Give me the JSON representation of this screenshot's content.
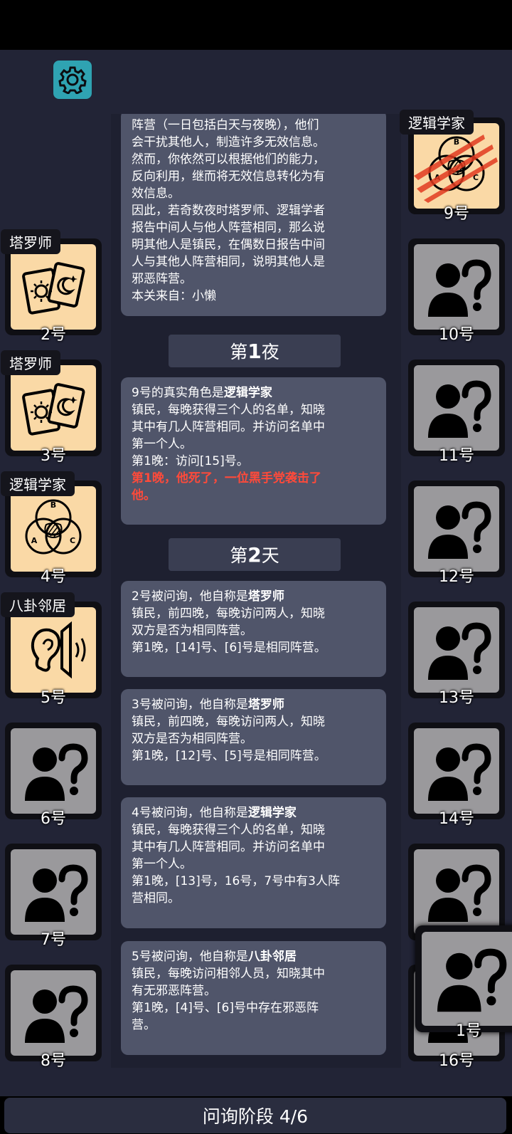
{
  "stage": "问询阶段 4/6",
  "intro": {
    "lines": [
      "阵营（一日包括白天与夜晚），他们",
      "会干扰其他人，制造许多无效信息。",
      "然而，你依然可以根据他们的能力，",
      "反向利用，继而将无效信息转化为有",
      "效信息。",
      "因此，若奇数夜时塔罗师、逻辑学者",
      "报告中间人与他人阵营相同，那么说",
      "明其他人是镇民，在偶数日报告中间",
      "人与其他人阵营相同，说明其他人是",
      "邪恶阵营。",
      "本关来自：小懒"
    ]
  },
  "phase1": {
    "pre": "第",
    "num": "1",
    "post": "夜"
  },
  "phase2": {
    "pre": "第",
    "num": "2",
    "post": "天"
  },
  "night1": {
    "head": "9号的真实角色是",
    "role": "逻辑学家",
    "lines": [
      "镇民，每晚获得三个人的名单，知晓",
      "其中有几人阵营相同。并访问名单中",
      "第一个人。",
      "第1晚：访问[15]号。"
    ],
    "red1": "第1晚，他死了，一位黑手党袭击了",
    "red2": "他。"
  },
  "q2": {
    "head": "2号被问询，他自称是",
    "role": "塔罗师",
    "lines": [
      "镇民，前四晚，每晚访问两人，知晓",
      "双方是否为相同阵营。",
      "第1晚，[14]号、[6]号是相同阵营。"
    ]
  },
  "q3": {
    "head": "3号被问询，他自称是",
    "role": "塔罗师",
    "lines": [
      "镇民，前四晚，每晚访问两人，知晓",
      "双方是否为相同阵营。",
      "第1晚，[12]号、[5]号是相同阵营。"
    ]
  },
  "q4": {
    "head": "4号被问询，他自称是",
    "role": "逻辑学家",
    "lines": [
      "镇民，每晚获得三个人的名单，知晓",
      "其中有几人阵营相同。并访问名单中",
      "第一个人。",
      "第1晚，[13]号，16号，7号中有3人阵",
      "营相同。"
    ]
  },
  "q5": {
    "head": "5号被问询，他自称是",
    "role": "八卦邻居",
    "lines": [
      "镇民，每晚访问相邻人员，知晓其中",
      "有无邪恶阵营。",
      "第1晚，[4]号、[6]号中存在邪恶阵",
      "营。"
    ]
  },
  "players": {
    "p1": "1号",
    "p2": "2号",
    "p3": "3号",
    "p4": "4号",
    "p5": "5号",
    "p6": "6号",
    "p7": "7号",
    "p8": "8号",
    "p9": "9号",
    "p10": "10号",
    "p11": "11号",
    "p12": "12号",
    "p13": "13号",
    "p14": "14号",
    "p16": "16号"
  },
  "tags": {
    "t2": "塔罗师",
    "t3": "塔罗师",
    "t4": "逻辑学家",
    "t5": "八卦邻居",
    "t9": "逻辑学家"
  },
  "venn_letters": {
    "a": "A",
    "b": "B",
    "c": "C"
  },
  "icons": {
    "settings": "gear-icon",
    "unknown": "unknown-person-icon",
    "tarot": "tarot-cards-icon",
    "logic": "venn-diagram-icon",
    "gossip": "ear-icon",
    "claw": "claw-scratch-icon"
  },
  "colors": {
    "gear_bg": "#2fa3b2",
    "card_known": "#fad9a6",
    "card_unknown": "#9a999c",
    "death_text": "#ff4a3a"
  }
}
